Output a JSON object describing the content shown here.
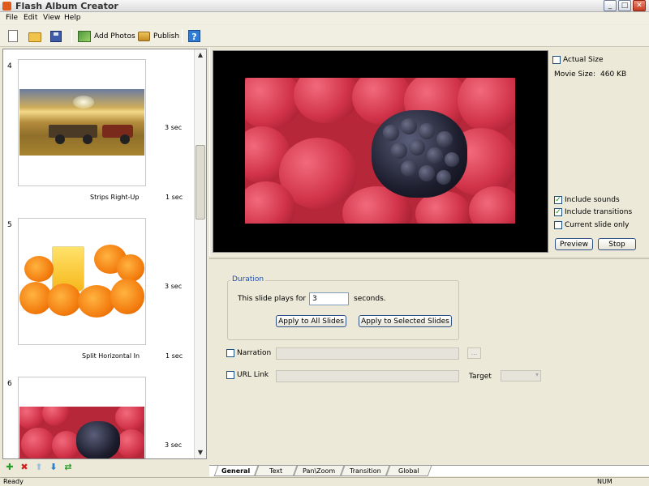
{
  "window": {
    "title": "Flash Album Creator",
    "controls": {
      "minimize": "_",
      "maximize": "□",
      "close": "✕"
    }
  },
  "menu": [
    "File",
    "Edit",
    "View",
    "Help"
  ],
  "toolbar": {
    "icons": [
      "new-file-icon",
      "open-folder-icon",
      "save-icon"
    ],
    "add_photos": "Add Photos",
    "publish": "Publish",
    "help": "?"
  },
  "slides": [
    {
      "number": "4",
      "duration": "3 sec",
      "transition": "Strips Right-Up",
      "transition_duration": "1 sec"
    },
    {
      "number": "5",
      "duration": "3 sec",
      "transition": "Split Horizontal In",
      "transition_duration": "1 sec"
    },
    {
      "number": "6",
      "duration": "3 sec"
    }
  ],
  "list_tools": [
    "add-icon",
    "delete-icon",
    "move-up-icon",
    "move-down-icon",
    "shuffle-icon"
  ],
  "preview": {
    "actual_size": "Actual Size",
    "actual_size_checked": false,
    "movie_size_label": "Movie Size:",
    "movie_size_value": "460 KB",
    "include_sounds": "Include sounds",
    "include_sounds_checked": true,
    "include_transitions": "Include transitions",
    "include_transitions_checked": true,
    "current_slide_only": "Current slide only",
    "current_slide_only_checked": false,
    "preview_btn": "Preview",
    "stop_btn": "Stop"
  },
  "duration": {
    "legend": "Duration",
    "label": "This slide plays for",
    "value": "3",
    "unit": "seconds.",
    "apply_all": "Apply to All Slides",
    "apply_selected": "Apply to Selected Slides"
  },
  "narration": {
    "label": "Narration",
    "checked": false,
    "browse": "..."
  },
  "url_link": {
    "label": "URL Link",
    "checked": false,
    "target_label": "Target"
  },
  "tabs": [
    "General",
    "Text",
    "Pan\\Zoom",
    "Transition",
    "Global"
  ],
  "active_tab": "General",
  "status": {
    "left": "Ready",
    "right": "NUM"
  },
  "colors": {
    "accent": "#1f4fb2",
    "checkmark": "#1b8a1b"
  }
}
